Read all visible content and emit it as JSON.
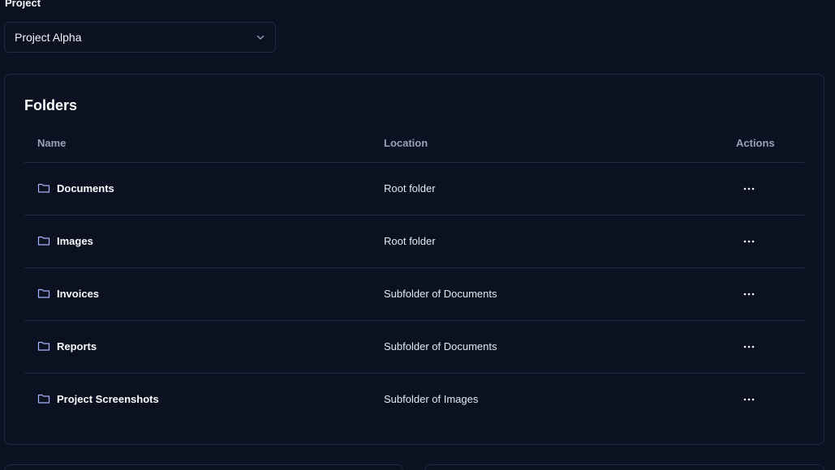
{
  "project": {
    "label": "Project",
    "selected": "Project Alpha"
  },
  "folders": {
    "title": "Folders",
    "columns": {
      "name": "Name",
      "location": "Location",
      "actions": "Actions"
    },
    "rows": [
      {
        "name": "Documents",
        "location": "Root folder"
      },
      {
        "name": "Images",
        "location": "Root folder"
      },
      {
        "name": "Invoices",
        "location": "Subfolder of Documents"
      },
      {
        "name": "Reports",
        "location": "Subfolder of Documents"
      },
      {
        "name": "Project Screenshots",
        "location": "Subfolder of Images"
      }
    ]
  },
  "icons": {
    "folder": "folder-icon",
    "actions": "more-horizontal-icon",
    "select": "chevron-down-icon"
  },
  "colors": {
    "background": "#0b1120",
    "border": "#1f2a3d",
    "folder_icon": "#a5b4fc"
  }
}
